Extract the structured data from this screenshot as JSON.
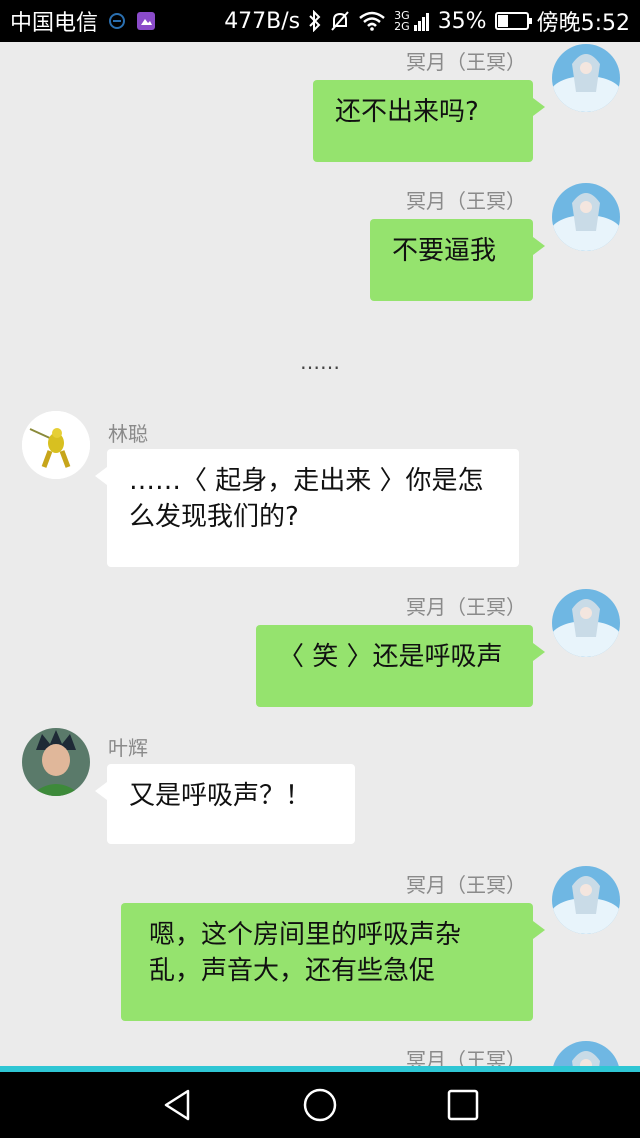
{
  "status_bar": {
    "carrier": "中国电信",
    "speed": "477B/s",
    "network_top": "3G",
    "network_bottom": "2G",
    "battery_percent": "35%",
    "battery_level": 0.35,
    "time": "傍晚5:52"
  },
  "chat": {
    "separator": "……",
    "messages": [
      {
        "sender": "冥月（王冥）",
        "text": "还不出来吗?"
      },
      {
        "sender": "冥月（王冥）",
        "text": "不要逼我"
      },
      {
        "sender": "林聪",
        "text": "……〈 起身，走出来 〉你是怎么发现我们的?"
      },
      {
        "sender": "冥月（王冥）",
        "text": "〈 笑 〉还是呼吸声"
      },
      {
        "sender": "叶辉",
        "text": "又是呼吸声？！"
      },
      {
        "sender": "冥月（王冥）",
        "text": "嗯，这个房间里的呼吸声杂乱，声音大，还有些急促"
      },
      {
        "sender": "冥月（王冥）",
        "text": ""
      }
    ]
  },
  "colors": {
    "my_bubble": "#95e36e",
    "other_bubble": "#ffffff",
    "background": "#ebebeb",
    "accent_bar": "#2fc6d4"
  },
  "icons": {
    "nav_back": "back-triangle-icon",
    "nav_home": "home-circle-icon",
    "nav_recent": "recent-square-icon"
  }
}
